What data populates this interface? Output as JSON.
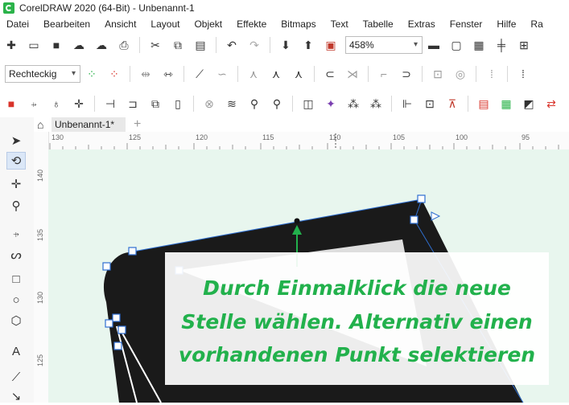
{
  "window": {
    "title": "CorelDRAW 2020 (64-Bit) - Unbenannt-1"
  },
  "menu": [
    "Datei",
    "Bearbeiten",
    "Ansicht",
    "Layout",
    "Objekt",
    "Effekte",
    "Bitmaps",
    "Text",
    "Tabelle",
    "Extras",
    "Fenster",
    "Hilfe",
    "Ra"
  ],
  "toolbar": {
    "zoom_value": "458%"
  },
  "propertybar": {
    "curve_type": "Rechteckig"
  },
  "document": {
    "tab_label": "Unbenannt-1*"
  },
  "ruler": {
    "top_ticks": [
      "130",
      "125",
      "120",
      "115",
      "110",
      "105",
      "100",
      "95"
    ],
    "left_ticks": [
      "140",
      "135",
      "130",
      "125"
    ]
  },
  "callout": {
    "lines": [
      "Durch Einmalklick die neue",
      "Stelle wählen. Alternativ einen",
      "vorhandenen Punkt selektieren"
    ]
  },
  "colors": {
    "canvas": "#e8f6ee",
    "callout_text": "#22b14c",
    "shape_fill": "#1a1a1a",
    "node_outline": "#2f6fd1"
  }
}
